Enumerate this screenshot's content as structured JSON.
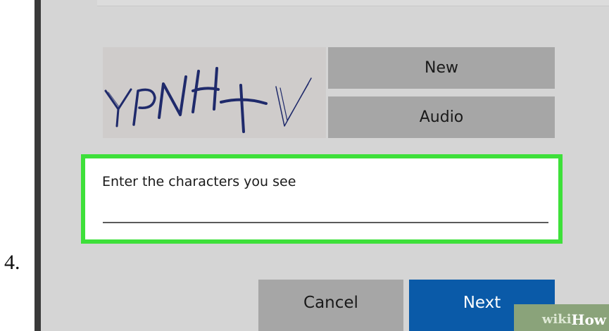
{
  "step": {
    "number": "4."
  },
  "captcha": {
    "characters": [
      "Y",
      "P",
      "N",
      "H",
      "+",
      "V"
    ],
    "ink_color": "#1f2a6b",
    "background_color": "#cfcccb"
  },
  "buttons": {
    "new_label": "New",
    "audio_label": "Audio",
    "cancel_label": "Cancel",
    "next_label": "Next"
  },
  "input": {
    "label": "Enter the characters you see",
    "value": "",
    "highlight_color": "#3ee03a"
  },
  "colors": {
    "primary_button": "#0a5aa8",
    "secondary_button": "#a6a6a6",
    "panel_background": "#d5d5d5"
  },
  "watermark": {
    "wiki": "wiki",
    "how": "How"
  }
}
